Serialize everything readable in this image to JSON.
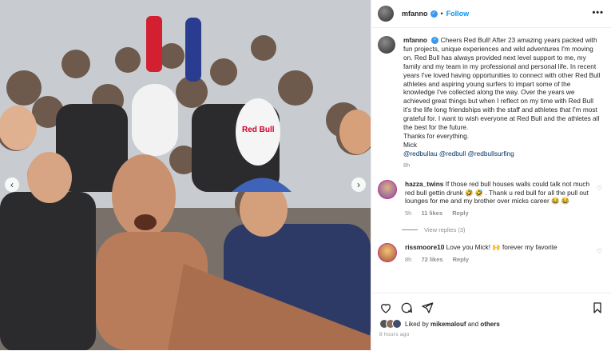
{
  "header": {
    "username": "mfanno",
    "follow_label": "Follow",
    "more_label": "•••"
  },
  "caption": {
    "username": "mfanno",
    "text": "Cheers Red Bull! After 23 amazing years packed with fun projects, unique experiences and wild adventures I'm moving on. Red Bull has always provided next level support to me, my family and my team in my professional and personal life. In recent years I've loved having opportunities to connect with other Red Bull athletes and aspiring young surfers to impart some of the knowledge I've collected along the way. Over the years we achieved great things but when I reflect on my time with Red Bull it's the life long friendships with the staff and athletes that I'm most grateful for. I want to wish everyone at Red Bull and the athletes all the best for the future.",
    "thanks": "Thanks for everything.",
    "signoff": "Mick",
    "tags": "@redbullau @redbull @redbullsurfing",
    "age": "8h"
  },
  "comments": [
    {
      "username": "hazza_twins",
      "text": "If those red bull houses walls could talk not much red bull gettin drunk 🤣 🤣 . Thank u red bull for all the pull out lounges for me and my brother over micks career 😂 😂",
      "age": "5h",
      "likes": "11 likes",
      "reply_label": "Reply",
      "view_replies": "View replies (3)"
    },
    {
      "username": "rissmoore10",
      "text": "Love you Mick! 🙌 forever my favorite",
      "age": "8h",
      "likes": "72 likes",
      "reply_label": "Reply"
    }
  ],
  "likes_line": {
    "prefix": "Liked by",
    "user": "mikemalouf",
    "and": "and",
    "others": "others"
  },
  "timestamp": "8 hours ago",
  "colors": {
    "accent": "#0095f6",
    "verified": "#3897f0",
    "muted": "#8e8e8e"
  }
}
